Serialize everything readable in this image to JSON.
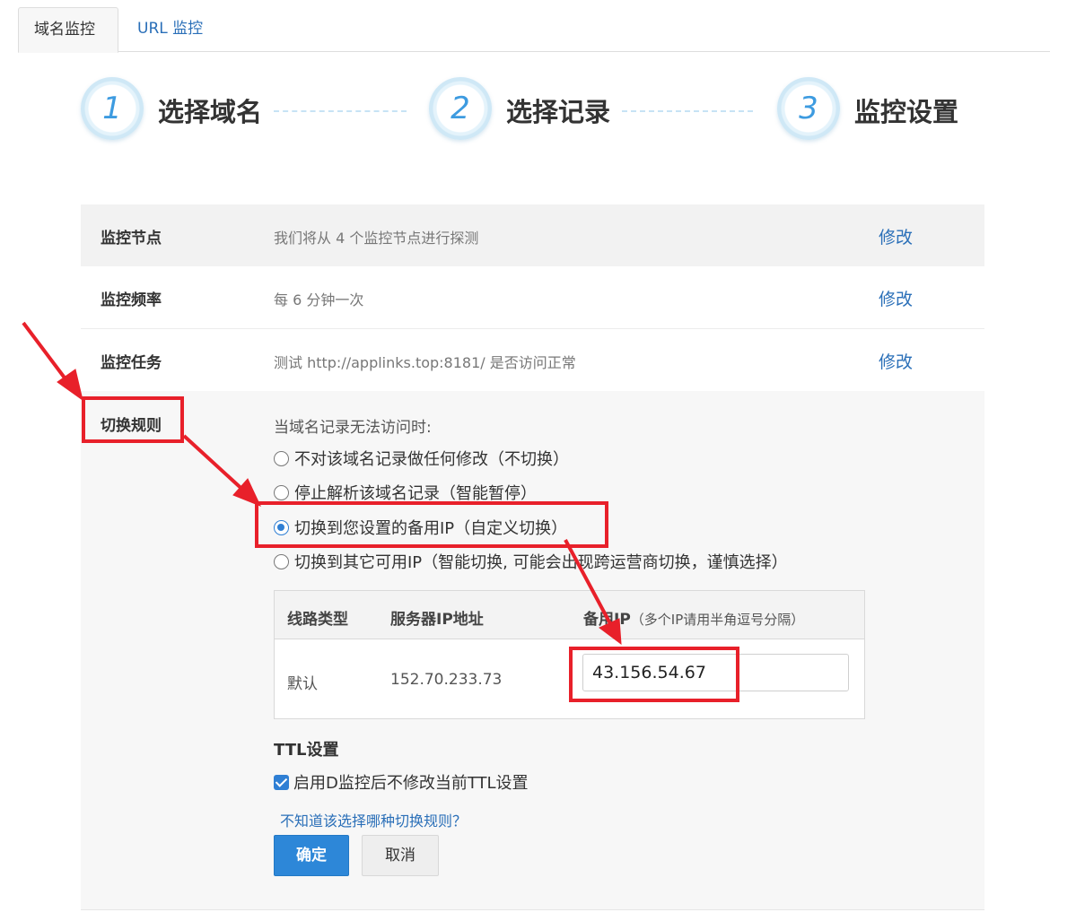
{
  "tabs": [
    {
      "label": "域名监控",
      "active": true
    },
    {
      "label": "URL 监控",
      "active": false
    }
  ],
  "steps": [
    {
      "num": "1",
      "label": "选择域名"
    },
    {
      "num": "2",
      "label": "选择记录"
    },
    {
      "num": "3",
      "label": "监控设置"
    }
  ],
  "settings": [
    {
      "label": "监控节点",
      "value": "我们将从 4 个监控节点进行探测",
      "edit": "修改"
    },
    {
      "label": "监控频率",
      "value": "每 6 分钟一次",
      "edit": "修改"
    },
    {
      "label": "监控任务",
      "value": "测试 http://applinks.top:8181/ 是否访问正常",
      "edit": "修改"
    }
  ],
  "switch_rule": {
    "label": "切换规则",
    "prompt": "当域名记录无法访问时:",
    "options": [
      {
        "label": "不对该域名记录做任何修改（不切换）",
        "checked": false
      },
      {
        "label": "停止解析该域名记录（智能暂停）",
        "checked": false
      },
      {
        "label": "切换到您设置的备用IP（自定义切换）",
        "checked": true
      },
      {
        "label": "切换到其它可用IP（智能切换, 可能会出现跨运营商切换，谨慎选择）",
        "checked": false
      }
    ],
    "table": {
      "headers": {
        "line_type": "线路类型",
        "server_ip": "服务器IP地址",
        "backup_ip": "备用IP",
        "backup_ip_hint": "（多个IP请用半角逗号分隔）"
      },
      "rows": [
        {
          "line_type": "默认",
          "server_ip": "152.70.233.73",
          "backup_ip": "43.156.54.67"
        }
      ]
    },
    "ttl": {
      "title": "TTL设置",
      "checkbox_label": "启用D监控后不修改当前TTL设置",
      "checked": true
    },
    "help_link": "不知道该选择哪种切换规则？",
    "confirm_label": "确定",
    "cancel_label": "取消"
  },
  "colors": {
    "accent": "#2d87d8",
    "link": "#2a6fb8",
    "annotation": "#e8202a"
  }
}
